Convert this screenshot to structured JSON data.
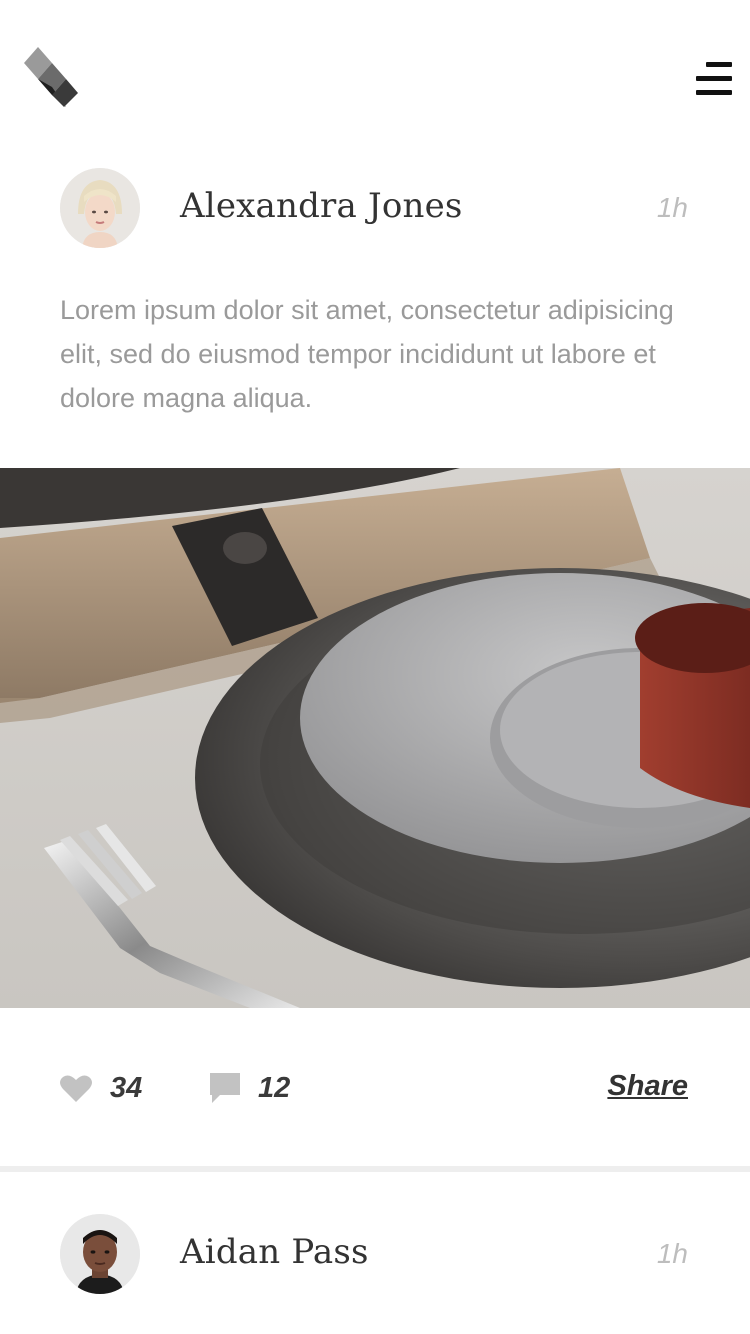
{
  "header": {
    "logo_icon": "cube-logo-icon",
    "menu_icon": "hamburger-menu-icon"
  },
  "posts": [
    {
      "author": "Alexandra Jones",
      "time": "1h",
      "body": "Lorem ipsum dolor sit amet, consectetur adipisicing elit, sed do eiusmod tempor incididunt ut labore et dolore magna aliqua.",
      "likes": "34",
      "comments": "12",
      "share_label": "Share"
    },
    {
      "author": "Aidan Pass",
      "time": "1h"
    }
  ],
  "colors": {
    "text_dark": "#333333",
    "text_muted": "#9a9a9a",
    "time_gray": "#bdbdbd",
    "icon_gray": "#c2c2c2"
  }
}
